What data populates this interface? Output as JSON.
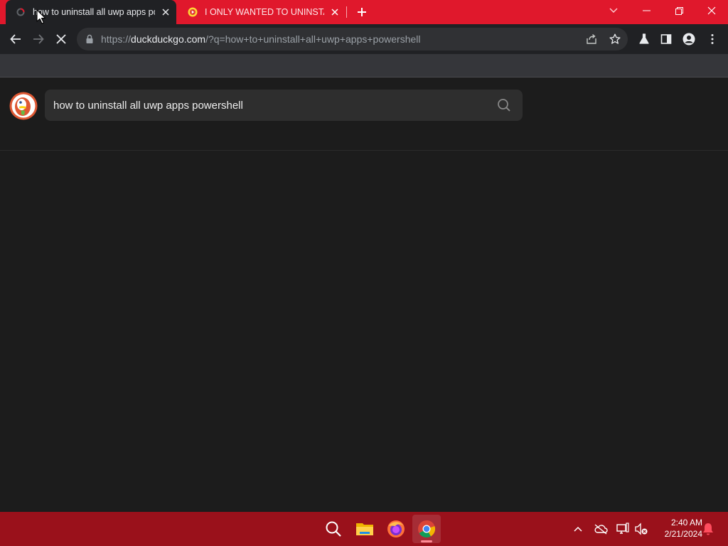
{
  "browser": {
    "tabs": [
      {
        "title": "how to uninstall all uwp apps powershell at DuckDuckGo",
        "active": true
      },
      {
        "title": "I ONLY WANTED TO UNINSTALL",
        "active": false
      }
    ],
    "url": {
      "scheme": "https://",
      "host": "duckduckgo.com",
      "path": "/?q=how+to+uninstall+all+uwp+apps+powershell"
    },
    "colors": {
      "frame": "#e0182c",
      "toolbar": "#202124"
    }
  },
  "page": {
    "search": {
      "value": "how to uninstall all uwp apps powershell"
    }
  },
  "taskbar": {
    "apps": [
      "search-icon",
      "file-explorer-icon",
      "firefox-icon",
      "chrome-icon"
    ],
    "clock": {
      "time": "2:40 AM",
      "date": "2/21/2024"
    },
    "colors": {
      "background": "#9a111b"
    }
  }
}
